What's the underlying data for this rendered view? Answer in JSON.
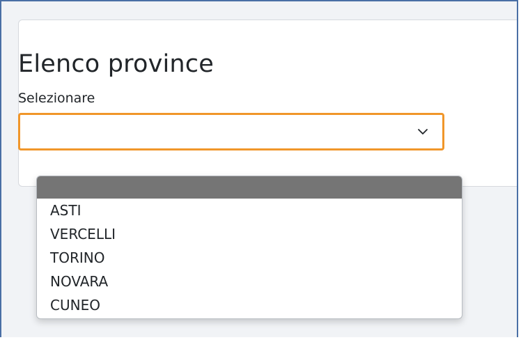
{
  "page": {
    "title": "Elenco province",
    "select_label": "Selezionare",
    "selected_value": ""
  },
  "dropdown": {
    "options": [
      "",
      "ASTI",
      "VERCELLI",
      "TORINO",
      "NOVARA",
      "CUNEO"
    ],
    "highlighted_index": 0
  },
  "colors": {
    "focus_border": "#f0962a",
    "highlight": "#757575",
    "frame_border": "#4a6fa5"
  },
  "icons": {
    "select": "chevron-down-icon"
  }
}
